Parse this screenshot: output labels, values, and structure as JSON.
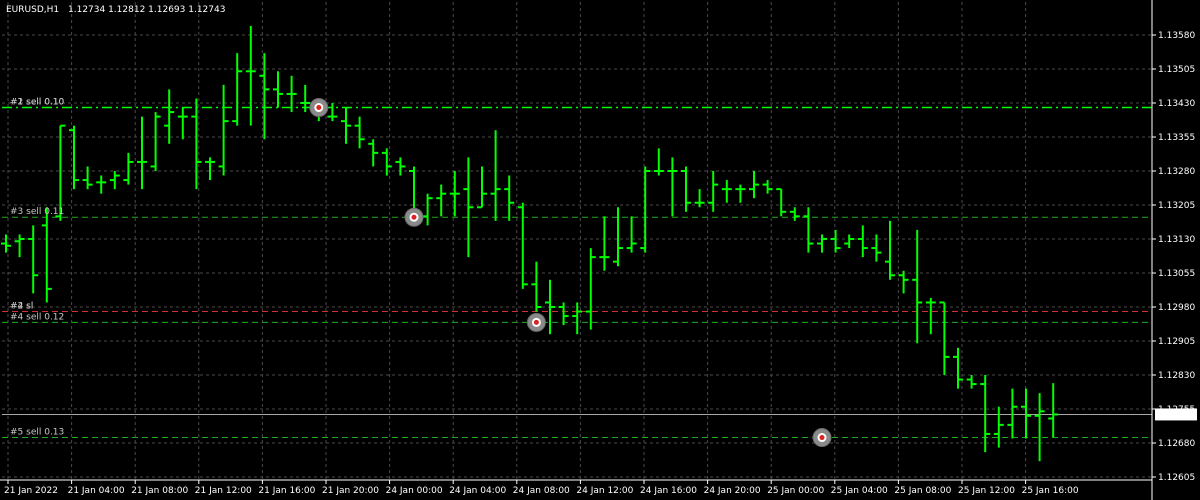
{
  "header": {
    "symbol": "EURUSD,H1",
    "ohlc": "1.12734 1.12812 1.12693 1.12743"
  },
  "colors": {
    "background": "#000000",
    "grid": "#4a4a4a",
    "bar": "#00ff00",
    "order_line": "#22aa22",
    "sl_line": "#cc3333",
    "current_price_line": "#c0c0c0",
    "price_box_bg": "#ffffff",
    "price_box_text": "#000000"
  },
  "current_price": "1.12743",
  "order_labels": [
    {
      "text": "#1 sell 0.10",
      "price": 1.1342
    },
    {
      "text": "#2 sell 0.10",
      "price": 1.1342
    },
    {
      "text": "#3 sell 0.11",
      "price": 1.13178
    },
    {
      "text": "#4 sl",
      "price": 1.1297
    },
    {
      "text": "#2 sl",
      "price": 1.1297
    },
    {
      "text": "#4 sell 0.12",
      "price": 1.12946
    },
    {
      "text": "#5 sell 0.13",
      "price": 1.12692
    }
  ],
  "chart_data": {
    "type": "ohlc",
    "title": "",
    "y_ticks": [
      "1.13580",
      "1.13505",
      "1.13430",
      "1.13355",
      "1.13280",
      "1.13205",
      "1.13130",
      "1.13055",
      "1.12980",
      "1.12905",
      "1.12830",
      "1.12755",
      "1.12680",
      "1.12605"
    ],
    "x_ticks": [
      "21 Jan 2022",
      "21 Jan 04:00",
      "21 Jan 08:00",
      "21 Jan 12:00",
      "21 Jan 16:00",
      "21 Jan 20:00",
      "24 Jan 00:00",
      "24 Jan 04:00",
      "24 Jan 08:00",
      "24 Jan 12:00",
      "24 Jan 16:00",
      "24 Jan 20:00",
      "25 Jan 00:00",
      "25 Jan 04:00",
      "25 Jan 08:00",
      "25 Jan 12:00",
      "25 Jan 16:00"
    ],
    "ylim": [
      1.1258,
      1.1362
    ],
    "horizontal_lines": [
      {
        "label": "#1 sell 0.10",
        "price": 1.1342,
        "style": "dashdot"
      },
      {
        "label": "#3 sell 0.11",
        "price": 1.13178,
        "style": "dashed"
      },
      {
        "label": "#4 sl",
        "price": 1.1297,
        "style": "sl"
      },
      {
        "label": "#4 sell 0.12",
        "price": 1.12946,
        "style": "dashed"
      },
      {
        "label": "#5 sell 0.13",
        "price": 1.12692,
        "style": "dashed"
      },
      {
        "label": "current",
        "price": 1.12743,
        "style": "current"
      }
    ],
    "entries": [
      {
        "bar_index": 23,
        "price": 1.1342
      },
      {
        "bar_index": 30,
        "price": 1.13178
      },
      {
        "bar_index": 39,
        "price": 1.12946
      },
      {
        "bar_index": 60,
        "price": 1.12692
      }
    ],
    "bars": [
      {
        "o": 1.1312,
        "h": 1.1314,
        "l": 1.131,
        "c": 1.13115
      },
      {
        "o": 1.13125,
        "h": 1.1314,
        "l": 1.1309,
        "c": 1.1313
      },
      {
        "o": 1.1313,
        "h": 1.1316,
        "l": 1.1301,
        "c": 1.1305
      },
      {
        "o": 1.1316,
        "h": 1.132,
        "l": 1.1299,
        "c": 1.1302
      },
      {
        "o": 1.1318,
        "h": 1.1338,
        "l": 1.1317,
        "c": 1.1338
      },
      {
        "o": 1.1337,
        "h": 1.1338,
        "l": 1.1324,
        "c": 1.1326
      },
      {
        "o": 1.1326,
        "h": 1.1329,
        "l": 1.1324,
        "c": 1.1325
      },
      {
        "o": 1.13255,
        "h": 1.1327,
        "l": 1.1323,
        "c": 1.13255
      },
      {
        "o": 1.1326,
        "h": 1.1328,
        "l": 1.1324,
        "c": 1.1327
      },
      {
        "o": 1.1326,
        "h": 1.1332,
        "l": 1.1325,
        "c": 1.133
      },
      {
        "o": 1.133,
        "h": 1.134,
        "l": 1.1324,
        "c": 1.133
      },
      {
        "o": 1.1329,
        "h": 1.1341,
        "l": 1.1328,
        "c": 1.134
      },
      {
        "o": 1.1338,
        "h": 1.1346,
        "l": 1.1334,
        "c": 1.1341
      },
      {
        "o": 1.134,
        "h": 1.1342,
        "l": 1.1335,
        "c": 1.134
      },
      {
        "o": 1.134,
        "h": 1.1344,
        "l": 1.1324,
        "c": 1.133
      },
      {
        "o": 1.133,
        "h": 1.1331,
        "l": 1.1326,
        "c": 1.133
      },
      {
        "o": 1.1329,
        "h": 1.1347,
        "l": 1.1327,
        "c": 1.1339
      },
      {
        "o": 1.1339,
        "h": 1.1354,
        "l": 1.1338,
        "c": 1.135
      },
      {
        "o": 1.135,
        "h": 1.136,
        "l": 1.1338,
        "c": 1.135
      },
      {
        "o": 1.1349,
        "h": 1.1354,
        "l": 1.1335,
        "c": 1.1346
      },
      {
        "o": 1.1346,
        "h": 1.135,
        "l": 1.1342,
        "c": 1.1345
      },
      {
        "o": 1.1345,
        "h": 1.1349,
        "l": 1.1341,
        "c": 1.1345
      },
      {
        "o": 1.1343,
        "h": 1.1347,
        "l": 1.1341,
        "c": 1.1343
      },
      {
        "o": 1.1342,
        "h": 1.1344,
        "l": 1.1339,
        "c": 1.1341
      },
      {
        "o": 1.134,
        "h": 1.1343,
        "l": 1.1339,
        "c": 1.134
      },
      {
        "o": 1.1339,
        "h": 1.1342,
        "l": 1.1334,
        "c": 1.1338
      },
      {
        "o": 1.1338,
        "h": 1.134,
        "l": 1.1333,
        "c": 1.1335
      },
      {
        "o": 1.1334,
        "h": 1.1335,
        "l": 1.1329,
        "c": 1.1332
      },
      {
        "o": 1.1332,
        "h": 1.1333,
        "l": 1.1327,
        "c": 1.1329
      },
      {
        "o": 1.133,
        "h": 1.1331,
        "l": 1.1327,
        "c": 1.1329
      },
      {
        "o": 1.1328,
        "h": 1.1329,
        "l": 1.1317,
        "c": 1.1319
      },
      {
        "o": 1.1318,
        "h": 1.1323,
        "l": 1.1316,
        "c": 1.1322
      },
      {
        "o": 1.1322,
        "h": 1.1325,
        "l": 1.1318,
        "c": 1.1323
      },
      {
        "o": 1.1323,
        "h": 1.1328,
        "l": 1.1318,
        "c": 1.1323
      },
      {
        "o": 1.1324,
        "h": 1.1331,
        "l": 1.1309,
        "c": 1.132
      },
      {
        "o": 1.132,
        "h": 1.1329,
        "l": 1.132,
        "c": 1.1323
      },
      {
        "o": 1.1323,
        "h": 1.1337,
        "l": 1.1317,
        "c": 1.1324
      },
      {
        "o": 1.1324,
        "h": 1.1327,
        "l": 1.1317,
        "c": 1.1321
      },
      {
        "o": 1.132,
        "h": 1.1321,
        "l": 1.1302,
        "c": 1.1303
      },
      {
        "o": 1.1303,
        "h": 1.1308,
        "l": 1.1297,
        "c": 1.1298
      },
      {
        "o": 1.1299,
        "h": 1.1304,
        "l": 1.1292,
        "c": 1.1298
      },
      {
        "o": 1.1298,
        "h": 1.1299,
        "l": 1.1294,
        "c": 1.1296
      },
      {
        "o": 1.1296,
        "h": 1.1299,
        "l": 1.1292,
        "c": 1.1297
      },
      {
        "o": 1.1297,
        "h": 1.1311,
        "l": 1.1293,
        "c": 1.1309
      },
      {
        "o": 1.1309,
        "h": 1.1318,
        "l": 1.1306,
        "c": 1.1309
      },
      {
        "o": 1.1308,
        "h": 1.132,
        "l": 1.1307,
        "c": 1.1311
      },
      {
        "o": 1.1311,
        "h": 1.1318,
        "l": 1.131,
        "c": 1.1312
      },
      {
        "o": 1.1311,
        "h": 1.1329,
        "l": 1.131,
        "c": 1.1328
      },
      {
        "o": 1.1328,
        "h": 1.1333,
        "l": 1.1327,
        "c": 1.1328
      },
      {
        "o": 1.1328,
        "h": 1.1331,
        "l": 1.1318,
        "c": 1.1328
      },
      {
        "o": 1.1328,
        "h": 1.1329,
        "l": 1.1319,
        "c": 1.1321
      },
      {
        "o": 1.1321,
        "h": 1.1324,
        "l": 1.132,
        "c": 1.1321
      },
      {
        "o": 1.1321,
        "h": 1.1328,
        "l": 1.1319,
        "c": 1.1325
      },
      {
        "o": 1.1324,
        "h": 1.1326,
        "l": 1.1321,
        "c": 1.1324
      },
      {
        "o": 1.1324,
        "h": 1.1325,
        "l": 1.1321,
        "c": 1.1324
      },
      {
        "o": 1.1324,
        "h": 1.1328,
        "l": 1.1322,
        "c": 1.1325
      },
      {
        "o": 1.1325,
        "h": 1.1326,
        "l": 1.1323,
        "c": 1.1324
      },
      {
        "o": 1.1324,
        "h": 1.1324,
        "l": 1.1318,
        "c": 1.1319
      },
      {
        "o": 1.1319,
        "h": 1.132,
        "l": 1.1317,
        "c": 1.1318
      },
      {
        "o": 1.1318,
        "h": 1.132,
        "l": 1.131,
        "c": 1.1312
      },
      {
        "o": 1.1312,
        "h": 1.1314,
        "l": 1.131,
        "c": 1.1313
      },
      {
        "o": 1.1313,
        "h": 1.1315,
        "l": 1.131,
        "c": 1.1311
      },
      {
        "o": 1.1312,
        "h": 1.1314,
        "l": 1.1311,
        "c": 1.1313
      },
      {
        "o": 1.1313,
        "h": 1.1316,
        "l": 1.1309,
        "c": 1.1311
      },
      {
        "o": 1.1311,
        "h": 1.1314,
        "l": 1.1308,
        "c": 1.131
      },
      {
        "o": 1.1308,
        "h": 1.1317,
        "l": 1.1304,
        "c": 1.1305
      },
      {
        "o": 1.1305,
        "h": 1.1306,
        "l": 1.1301,
        "c": 1.1304
      },
      {
        "o": 1.1304,
        "h": 1.1315,
        "l": 1.129,
        "c": 1.1299
      },
      {
        "o": 1.1299,
        "h": 1.13,
        "l": 1.1292,
        "c": 1.1299
      },
      {
        "o": 1.1299,
        "h": 1.1299,
        "l": 1.1283,
        "c": 1.1287
      },
      {
        "o": 1.1287,
        "h": 1.1289,
        "l": 1.128,
        "c": 1.1282
      },
      {
        "o": 1.1282,
        "h": 1.1283,
        "l": 1.128,
        "c": 1.1281
      },
      {
        "o": 1.1281,
        "h": 1.1283,
        "l": 1.1266,
        "c": 1.127
      },
      {
        "o": 1.127,
        "h": 1.1276,
        "l": 1.1267,
        "c": 1.1272
      },
      {
        "o": 1.1272,
        "h": 1.128,
        "l": 1.1269,
        "c": 1.1276
      },
      {
        "o": 1.1276,
        "h": 1.128,
        "l": 1.1269,
        "c": 1.1274
      },
      {
        "o": 1.1274,
        "h": 1.1279,
        "l": 1.1264,
        "c": 1.1275
      },
      {
        "o": 1.12734,
        "h": 1.12812,
        "l": 1.12693,
        "c": 1.12743
      }
    ]
  }
}
